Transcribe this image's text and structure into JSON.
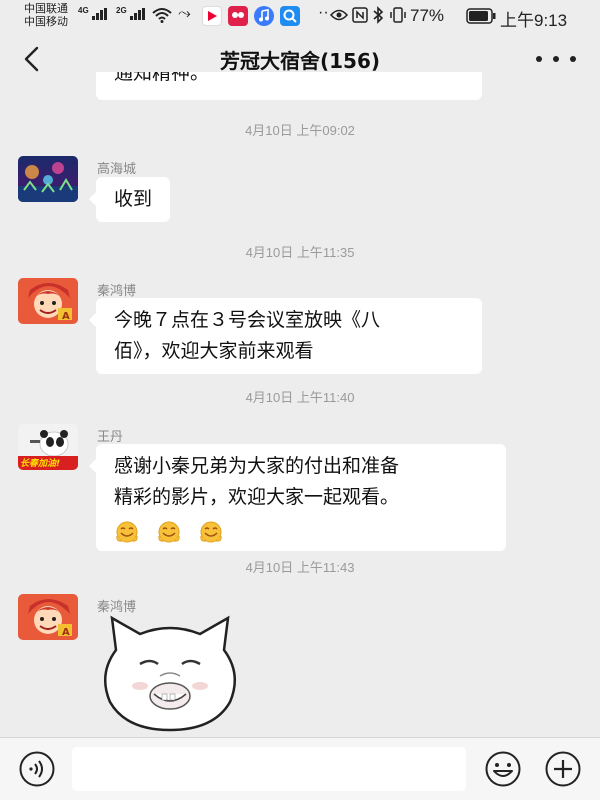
{
  "status_bar": {
    "carrier1": "中国联通",
    "carrier2": "中国移动",
    "net1": "4G",
    "net2": "2G",
    "battery": "77%",
    "time": "上午9:13"
  },
  "header": {
    "title": "芳冠大宿舍(156)"
  },
  "partial_message": "通知精神。",
  "messages": [
    {
      "timestamp": "4月10日 上午09:02",
      "sender": "高海城",
      "text": "收到"
    },
    {
      "timestamp": "4月10日 上午11:35",
      "sender": "秦鸿博",
      "lines": [
        "今晚７点在３号会议室放映《八",
        "佰》，欢迎大家前来观看"
      ]
    },
    {
      "timestamp": "4月10日 上午11:40",
      "sender": "王丹",
      "lines": [
        "感谢小秦兄弟为大家的付出和准备",
        "精彩的影片，欢迎大家一起观看。"
      ],
      "emoji": [
        "smiling-face-icon",
        "smiling-face-icon",
        "smiling-face-icon"
      ]
    },
    {
      "timestamp": "4月10日 上午11:43",
      "sender": "秦鸿博",
      "sticker": "cat-face-sticker"
    }
  ],
  "avatar_badges": {
    "wang_dan": "长春加油!"
  },
  "colors": {
    "background": "#ededed",
    "bubble": "#ffffff",
    "timestamp": "#9a9a9a",
    "sender": "#888888"
  }
}
